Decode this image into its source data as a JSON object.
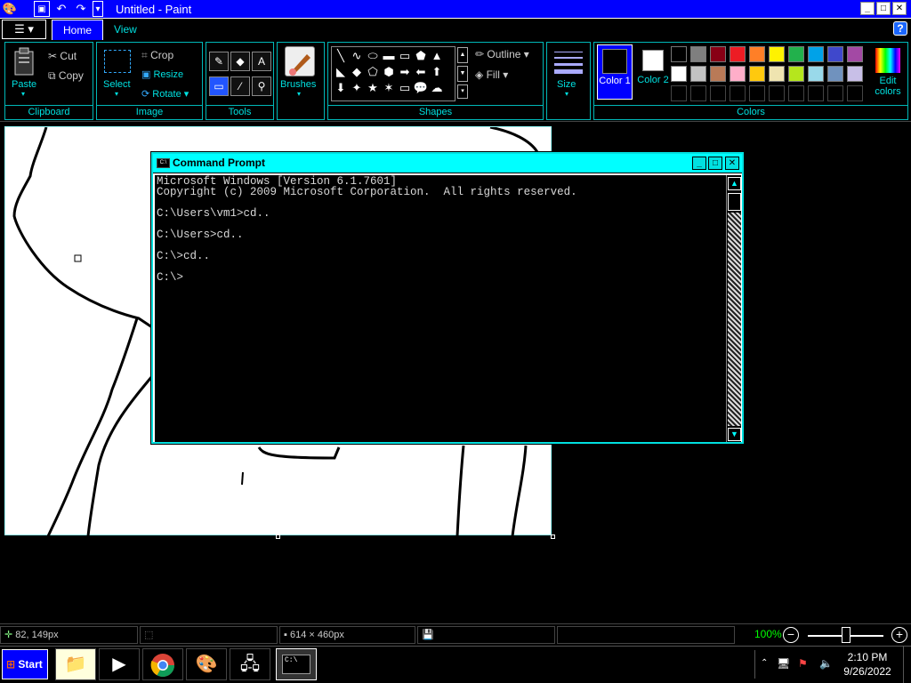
{
  "window": {
    "title": "Untitled - Paint",
    "controls": {
      "minimize": "_",
      "maximize": "□",
      "close": "✕"
    }
  },
  "tabs": {
    "home": "Home",
    "view": "View"
  },
  "ribbon": {
    "clipboard": {
      "label": "Clipboard",
      "paste": "Paste",
      "cut": "Cut",
      "copy": "Copy"
    },
    "image": {
      "label": "Image",
      "select": "Select",
      "crop": "Crop",
      "resize": "Resize",
      "rotate": "Rotate"
    },
    "tools": {
      "label": "Tools"
    },
    "brushes": {
      "label": "Brushes"
    },
    "shapes": {
      "label": "Shapes",
      "outline": "Outline",
      "fill": "Fill"
    },
    "size": {
      "label": "Size"
    },
    "colors": {
      "label": "Colors",
      "color1": "Color 1",
      "color2": "Color 2",
      "edit": "Edit colors",
      "color1_value": "#000000",
      "color2_value": "#ffffff",
      "palette_row1": [
        "#000000",
        "#7f7f7f",
        "#880015",
        "#ed1c24",
        "#ff7f27",
        "#fff200",
        "#22b14c",
        "#00a2e8",
        "#3f48cc",
        "#a349a4"
      ],
      "palette_row2": [
        "#ffffff",
        "#c3c3c3",
        "#b97a57",
        "#ffaec9",
        "#ffc90e",
        "#efe4b0",
        "#b5e61d",
        "#99d9ea",
        "#7092be",
        "#c8bfe7"
      ]
    }
  },
  "cmd": {
    "title": "Command Prompt",
    "icon_text": "C:\\",
    "lines": [
      "Microsoft Windows [Version 6.1.7601]",
      "Copyright (c) 2009 Microsoft Corporation.  All rights reserved.",
      "",
      "C:\\Users\\vm1>cd..",
      "",
      "C:\\Users>cd..",
      "",
      "C:\\>cd..",
      "",
      "C:\\>"
    ]
  },
  "status": {
    "cursor_pos": "82, 149px",
    "canvas_size": "614 × 460px",
    "zoom": "100%"
  },
  "taskbar": {
    "start": "Start",
    "time": "2:10 PM",
    "date": "9/26/2022"
  }
}
